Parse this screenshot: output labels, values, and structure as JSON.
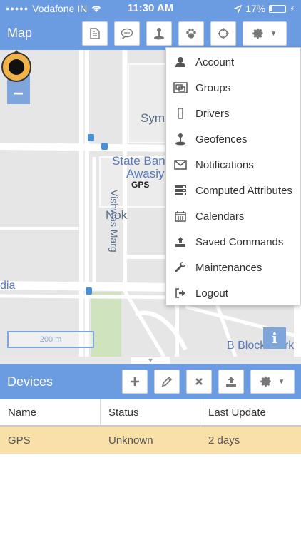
{
  "status_bar": {
    "carrier": "Vodafone IN",
    "time": "11:30 AM",
    "battery": "17%",
    "battery_level": 0.17
  },
  "map_header": {
    "title": "Map",
    "icons": [
      "report-icon",
      "chat-icon",
      "geofence-icon",
      "paw-icon",
      "crosshair-icon",
      "gear-icon"
    ]
  },
  "map": {
    "labels": {
      "sym": "Sym",
      "state_bank": "State Bank",
      "awasiy": "Awasiy",
      "nok": "Nok",
      "vishwas_marg": "Vishwas Marg",
      "dia": "dia",
      "b_block": "B Block Mark"
    },
    "zoom_in": "+",
    "zoom_out": "−",
    "scale": "200 m",
    "info": "i",
    "marker_label": "GPS"
  },
  "menu": {
    "items": [
      {
        "label": "Account",
        "icon": "user-icon"
      },
      {
        "label": "Groups",
        "icon": "groups-icon"
      },
      {
        "label": "Drivers",
        "icon": "driver-icon"
      },
      {
        "label": "Geofences",
        "icon": "geofence-icon"
      },
      {
        "label": "Notifications",
        "icon": "envelope-icon"
      },
      {
        "label": "Computed Attributes",
        "icon": "server-icon"
      },
      {
        "label": "Calendars",
        "icon": "calendar-icon"
      },
      {
        "label": "Saved Commands",
        "icon": "upload-icon"
      },
      {
        "label": "Maintenances",
        "icon": "wrench-icon"
      },
      {
        "label": "Logout",
        "icon": "logout-icon"
      }
    ]
  },
  "devices": {
    "title": "Devices",
    "icons": [
      "add-icon",
      "edit-icon",
      "remove-icon",
      "upload-icon",
      "gear-icon"
    ],
    "columns": [
      "Name",
      "Status",
      "Last Update"
    ],
    "rows": [
      {
        "name": "GPS",
        "status": "Unknown",
        "last_update": "2 days"
      }
    ]
  },
  "colors": {
    "header": "#6b9be0",
    "selected_row": "#f9e0a8",
    "marker": "#f0b24a"
  }
}
